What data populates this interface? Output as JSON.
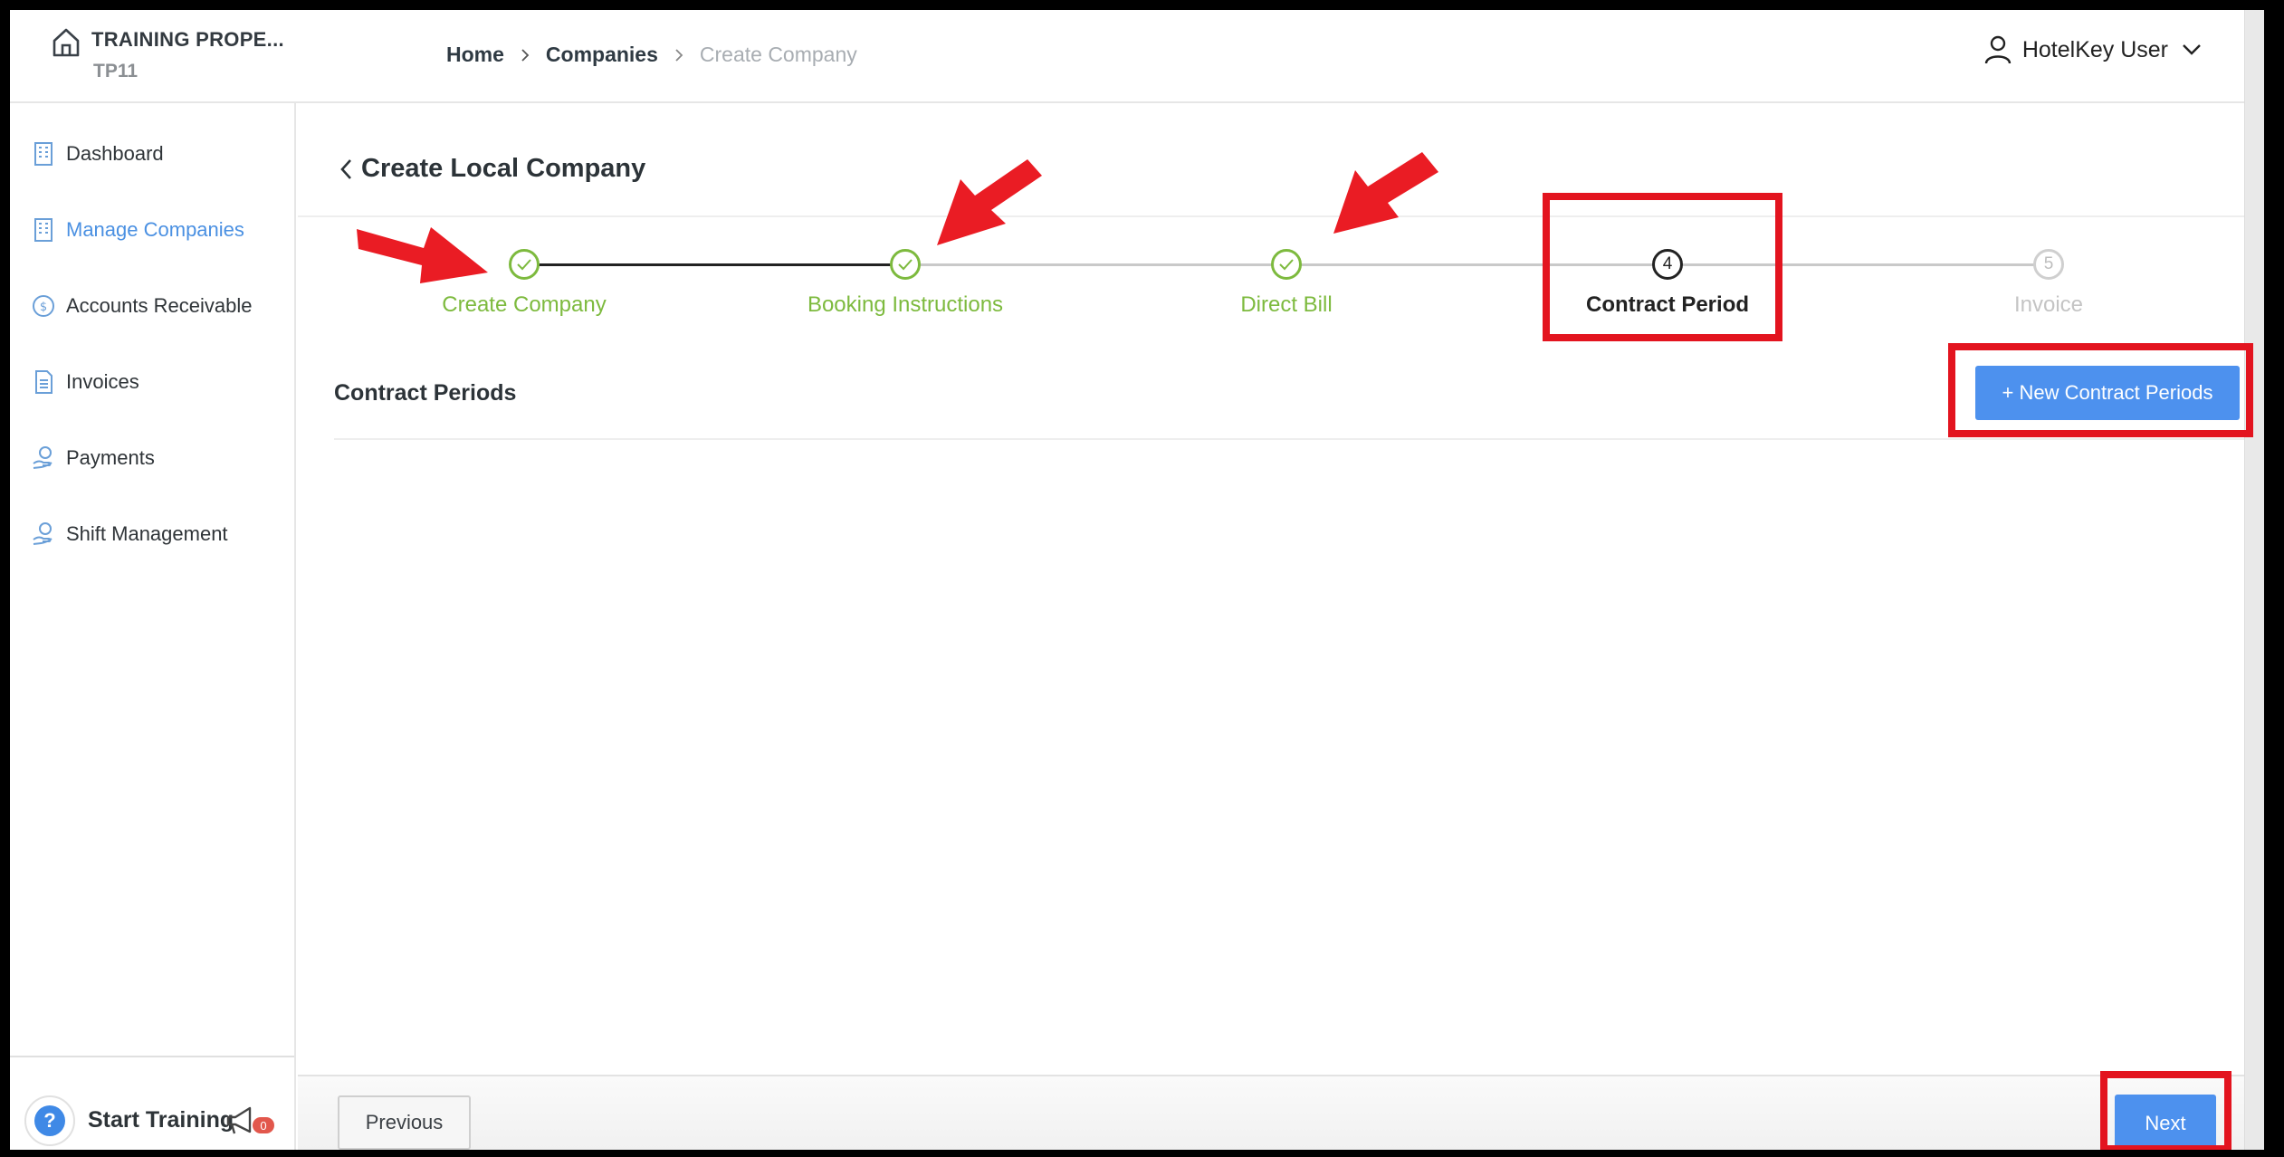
{
  "header": {
    "property_name": "TRAINING PROPE...",
    "property_code": "TP11",
    "breadcrumb": [
      "Home",
      "Companies",
      "Create Company"
    ],
    "user_name": "HotelKey User"
  },
  "sidebar": {
    "items": [
      {
        "label": "Dashboard",
        "icon": "building-icon"
      },
      {
        "label": "Manage Companies",
        "icon": "building-icon",
        "active": true
      },
      {
        "label": "Accounts Receivable",
        "icon": "dollar-coin-icon"
      },
      {
        "label": "Invoices",
        "icon": "document-icon"
      },
      {
        "label": "Payments",
        "icon": "hand-coin-icon"
      },
      {
        "label": "Shift Management",
        "icon": "hand-coin-icon"
      }
    ],
    "help_icon_label": "?",
    "start_training": "Start Training",
    "notification_count": "0"
  },
  "page": {
    "title": "Create Local Company"
  },
  "stepper": {
    "steps": [
      {
        "label": "Create Company",
        "state": "completed"
      },
      {
        "label": "Booking Instructions",
        "state": "completed"
      },
      {
        "label": "Direct Bill",
        "state": "completed"
      },
      {
        "label": "Contract Period",
        "state": "current",
        "number": "4"
      },
      {
        "label": "Invoice",
        "state": "pending",
        "number": "5"
      }
    ]
  },
  "content": {
    "section_title": "Contract Periods",
    "new_button": "+ New Contract Periods"
  },
  "footer": {
    "previous": "Previous",
    "next": "Next"
  },
  "colors": {
    "accent": "#4d91ee",
    "completed": "#7dba3e",
    "annotation": "#e3141f"
  }
}
